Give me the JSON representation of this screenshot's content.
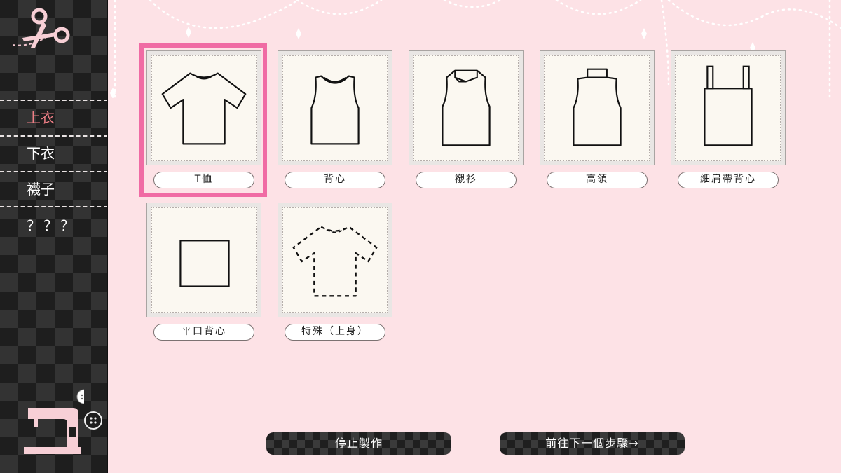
{
  "sidebar": {
    "logo_icon": "scissors-icon",
    "items": [
      {
        "label": "上衣",
        "active": true
      },
      {
        "label": "下衣",
        "active": false
      },
      {
        "label": "襪子",
        "active": false
      },
      {
        "label": "？？？",
        "active": false
      }
    ],
    "machine_icon": "sewing-machine-icon"
  },
  "garments": [
    {
      "label": "T恤",
      "icon": "tshirt-icon",
      "selected": true
    },
    {
      "label": "背心",
      "icon": "vest-icon",
      "selected": false
    },
    {
      "label": "襯衫",
      "icon": "shirt-icon",
      "selected": false
    },
    {
      "label": "高領",
      "icon": "turtleneck-icon",
      "selected": false
    },
    {
      "label": "細肩帶背心",
      "icon": "camisole-icon",
      "selected": false
    },
    {
      "label": "平口背心",
      "icon": "tube-top-icon",
      "selected": false
    },
    {
      "label": "特殊（上身）",
      "icon": "special-top-icon",
      "selected": false
    }
  ],
  "buttons": {
    "stop": "停止製作",
    "next": "前往下一個步驟→"
  },
  "colors": {
    "background": "#fde2e6",
    "accent_active": "#ef7f86",
    "selection": "#f06ba4"
  }
}
